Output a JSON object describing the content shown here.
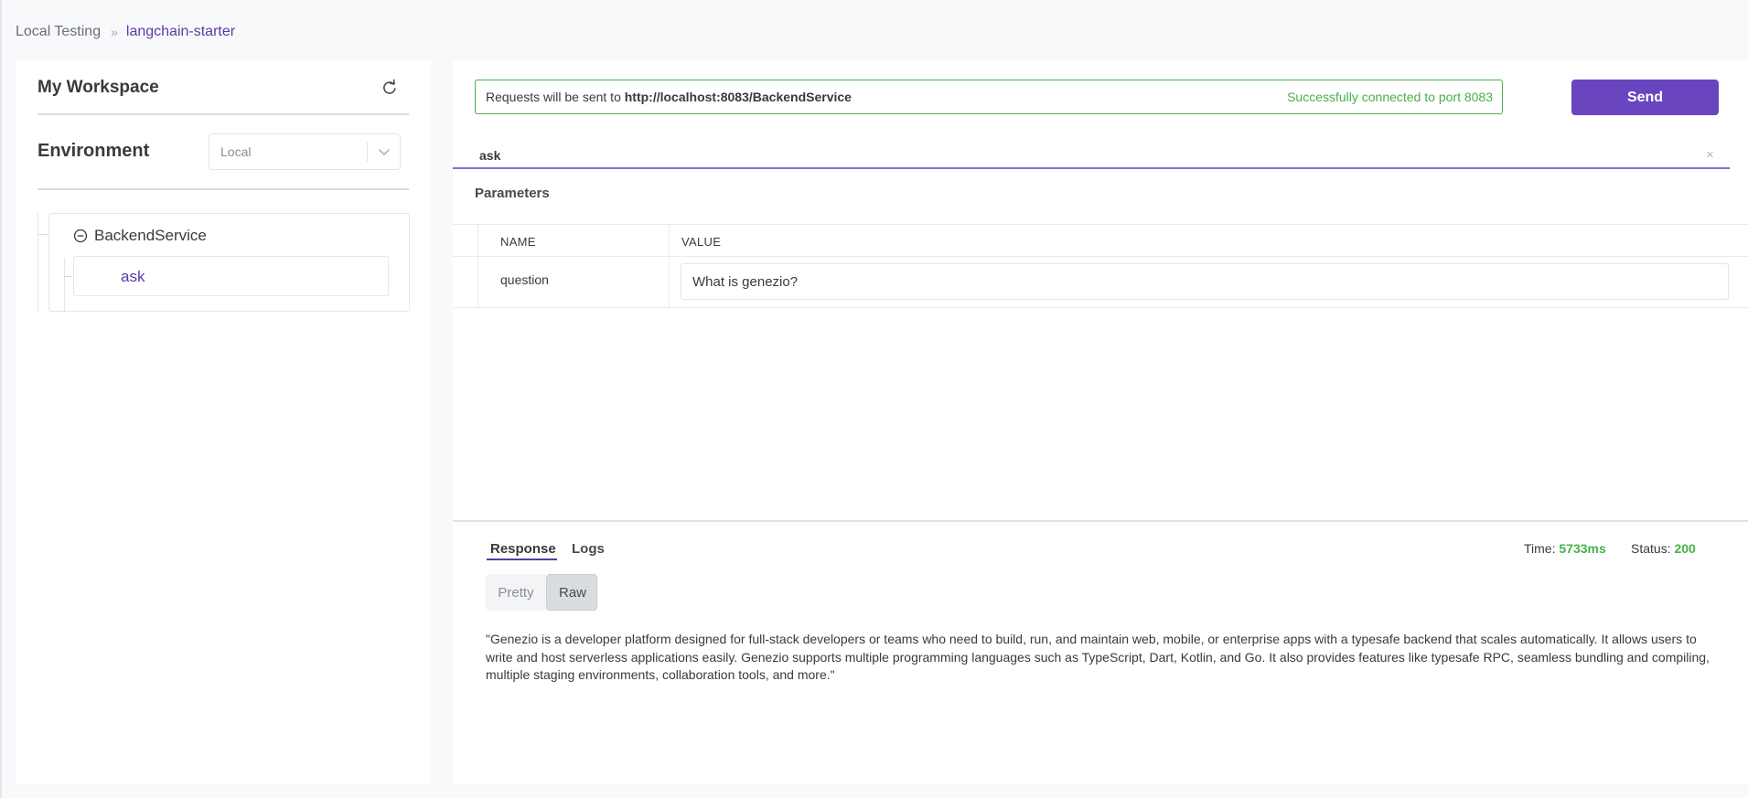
{
  "breadcrumb": {
    "root": "Local Testing",
    "separator": "»",
    "current": "langchain-starter"
  },
  "sidebar": {
    "workspace_title": "My Workspace",
    "refresh_icon": "refresh-icon",
    "environment_label": "Environment",
    "environment_select": {
      "value": "Local",
      "chevron_icon": "chevron-down-icon"
    },
    "tree": {
      "service": "BackendService",
      "collapse_icon": "minus-circle-icon",
      "methods": [
        "ask"
      ]
    }
  },
  "request": {
    "url_prefix": "Requests will be sent to ",
    "url": "http://localhost:8083/BackendService",
    "connection_status": "Successfully connected to port 8083",
    "send_label": "Send",
    "method_tab": "ask",
    "close_glyph": "×"
  },
  "params": {
    "title": "Parameters",
    "columns": [
      "NAME",
      "VALUE"
    ],
    "rows": [
      {
        "name": "question",
        "value": "What is genezio?"
      }
    ]
  },
  "response": {
    "tabs": [
      "Response",
      "Logs"
    ],
    "time_label": "Time: ",
    "time_value": "5733ms",
    "status_label": "Status: ",
    "status_value": "200",
    "format_options": [
      "Pretty",
      "Raw"
    ],
    "selected_format": "Raw",
    "body": "\"Genezio is a developer platform designed for full-stack developers or teams who need to build, run, and maintain web, mobile, or enterprise apps with a typesafe backend that scales automatically. It allows users to write and host serverless applications easily. Genezio supports multiple programming languages such as TypeScript, Dart, Kotlin, and Go. It also provides features like typesafe RPC, seamless bundling and compiling, multiple staging environments, collaboration tools, and more.\""
  },
  "colors": {
    "accent": "#6a45c0",
    "link": "#5b3aa8",
    "success": "#48b04a",
    "background": "#f8f9fa"
  }
}
